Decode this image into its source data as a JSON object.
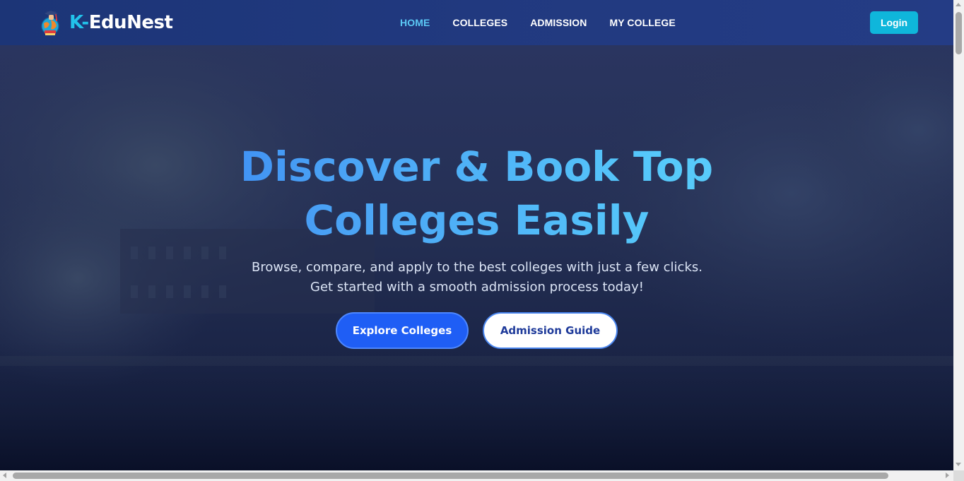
{
  "brand": {
    "prefix": "K-",
    "name": "EduNest",
    "logo_icon": "graduate-globe-icon",
    "prefix_color": "#22c3ea"
  },
  "nav": {
    "items": [
      {
        "label": "HOME",
        "active": true
      },
      {
        "label": "COLLEGES",
        "active": false
      },
      {
        "label": "ADMISSION",
        "active": false
      },
      {
        "label": "MY COLLEGE",
        "active": false
      }
    ],
    "active_color": "#5bc8f5",
    "login_label": "Login",
    "login_color": "#0fb6db"
  },
  "hero": {
    "headline_line1": "Discover & Book Top",
    "headline_line2": "Colleges Easily",
    "subtitle": "Browse, compare, and apply to the best colleges with just a few clicks. Get started with a smooth admission process today!",
    "primary_button": "Explore Colleges",
    "secondary_button": "Admission Guide",
    "primary_color": "#1f5ef5",
    "headline_gradient": [
      "#2a6ef0",
      "#62d8ff"
    ]
  }
}
